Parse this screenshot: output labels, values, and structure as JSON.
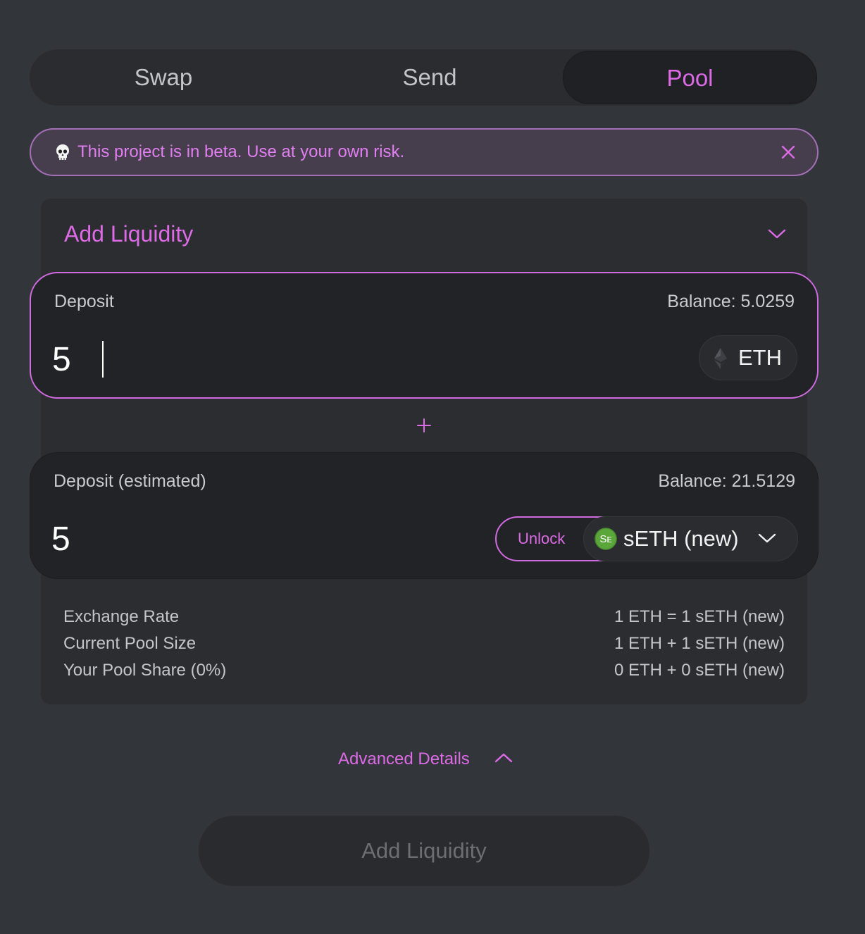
{
  "tabs": [
    {
      "label": "Swap",
      "active": false
    },
    {
      "label": "Send",
      "active": false
    },
    {
      "label": "Pool",
      "active": true
    }
  ],
  "banner": {
    "icon": "skull-icon",
    "message": "This project is in beta. Use at your own risk."
  },
  "panel": {
    "title": "Add Liquidity"
  },
  "deposit": {
    "label": "Deposit",
    "balance": "Balance: 5.0259",
    "amount": "5",
    "token": "ETH"
  },
  "deposit_estimated": {
    "label": "Deposit (estimated)",
    "balance": "Balance: 21.5129",
    "amount": "5",
    "unlock_label": "Unlock",
    "token": "sETH (new)",
    "token_icon_text": "Sᴇ"
  },
  "stats": [
    {
      "label": "Exchange Rate",
      "value": "1 ETH = 1 sETH (new)"
    },
    {
      "label": "Current Pool Size",
      "value": "1 ETH + 1 sETH (new)"
    },
    {
      "label": "Your Pool Share (0%)",
      "value": "0 ETH + 0 sETH (new)"
    }
  ],
  "advanced_label": "Advanced Details",
  "add_button_label": "Add Liquidity",
  "colors": {
    "accent": "#dc6be5",
    "background": "#323539",
    "card": "#222327"
  }
}
